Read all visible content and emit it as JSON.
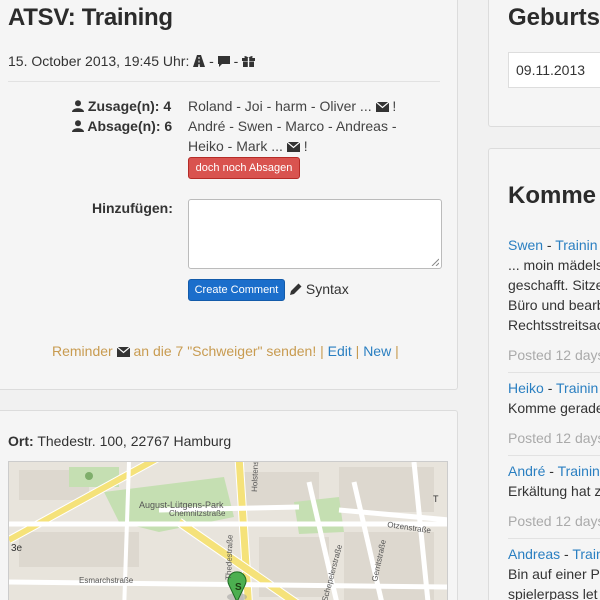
{
  "event": {
    "title": "ATSV: Training",
    "datetime": "15. October 2013, 19:45 Uhr:",
    "meta_sep1": "-",
    "meta_sep2": "-",
    "zusage_label": "Zusage(n): 4",
    "absage_label": "Absage(n): 6",
    "zusage_names": "Roland - Joi - harm - Oliver ...",
    "absage_line1": "André - Swen - Marco - Andreas -",
    "absage_line2": "Heiko - Mark ...",
    "exclaim": "!",
    "decline_button": "doch noch Absagen",
    "add_label": "Hinzufügen:",
    "comment_value": "",
    "create_button": "Create Comment",
    "syntax_label": "Syntax",
    "reminder_text1": "Reminder",
    "reminder_text2": "an die 7 \"Schweiger\" senden!",
    "pipe": "|",
    "edit_link": "Edit",
    "new_link": "New"
  },
  "location": {
    "label": "Ort:",
    "address": "Thedestr. 100, 22767 Hamburg",
    "map_labels": {
      "park": "August-Lütgens-Park",
      "street1": "Chemnitzstraße",
      "street2": "Esmarchstraße",
      "street3": "Otzenstraße",
      "street4": "Schepelerstraße",
      "street5": "Thedestraße",
      "street6": "Gerritstraße",
      "street7": "Holstenstraße",
      "marker": "S",
      "edge_left": "3e",
      "edge_right": "T"
    }
  },
  "birthdays": {
    "title": "Geburtst",
    "date": "09.11.2013"
  },
  "comments": {
    "title": "Komme",
    "items": [
      {
        "author": "Swen",
        "sep": "-",
        "event": "Trainin",
        "lines": [
          "... moin mädels",
          "geschafft. Sitze",
          "Büro und bearb",
          "Rechtsstreitsac"
        ],
        "posted": "Posted 12 days"
      },
      {
        "author": "Heiko",
        "sep": "-",
        "event": "Trainin",
        "lines": [
          "Komme gerade"
        ],
        "posted": "Posted 12 days"
      },
      {
        "author": "André",
        "sep": "-",
        "event": "Trainin",
        "lines": [
          "Erkältung hat z"
        ],
        "posted": "Posted 12 days"
      },
      {
        "author": "Andreas",
        "sep": "-",
        "event": "Train",
        "lines": [
          "Bin auf einer Pa",
          "spielerpass let"
        ],
        "posted": ""
      }
    ]
  },
  "colors": {
    "link": "#2a7fc1",
    "danger": "#d9534f",
    "primary": "#1b6ecb",
    "reminder": "#c89b50",
    "muted": "#aaaaaa"
  },
  "icons": [
    "user-icon",
    "envelope-icon",
    "road-icon",
    "comment-icon",
    "gift-icon",
    "pencil-icon",
    "map-marker-icon"
  ]
}
